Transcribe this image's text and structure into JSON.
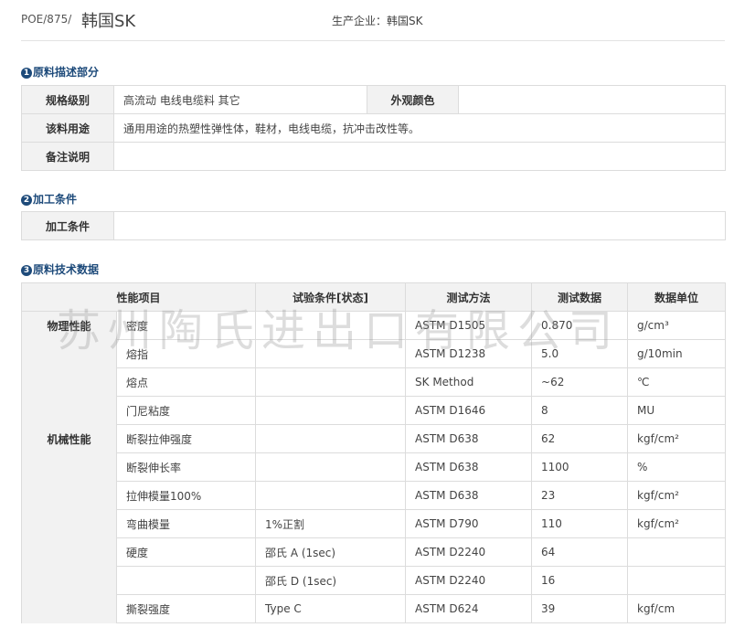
{
  "header": {
    "code": "POE/875/",
    "brand": "韩国SK",
    "producer": "生产企业：韩国SK"
  },
  "section1": {
    "num": "1",
    "title": "原料描述部分",
    "spec_label": "规格级别",
    "spec_value": "高流动 电线电缆料 其它",
    "color_label": "外观颜色",
    "color_value": "",
    "use_label": "该料用途",
    "use_value": "通用用途的热塑性弹性体，鞋材，电线电缆，抗冲击改性等。",
    "note_label": "备注说明",
    "note_value": ""
  },
  "section2": {
    "num": "2",
    "title": "加工条件",
    "label": "加工条件",
    "value": ""
  },
  "section3": {
    "num": "3",
    "title": "原料技术数据",
    "headers": [
      "性能项目",
      "试验条件[状态]",
      "测试方法",
      "测试数据",
      "数据单位"
    ],
    "rows": [
      {
        "group": "物理性能",
        "item": "密度",
        "cond": "",
        "method": "ASTM D1505",
        "data": "0.870",
        "unit": "g/cm³"
      },
      {
        "group": "",
        "item": "熔指",
        "cond": "",
        "method": "ASTM D1238",
        "data": "5.0",
        "unit": "g/10min"
      },
      {
        "group": "",
        "item": "熔点",
        "cond": "",
        "method": "SK Method",
        "data": "~62",
        "unit": "℃"
      },
      {
        "group": "",
        "item": "门尼粘度",
        "cond": "",
        "method": "ASTM D1646",
        "data": "8",
        "unit": "MU"
      },
      {
        "group": "机械性能",
        "item": "断裂拉伸强度",
        "cond": "",
        "method": "ASTM D638",
        "data": "62",
        "unit": "kgf/cm²"
      },
      {
        "group": "",
        "item": "断裂伸长率",
        "cond": "",
        "method": "ASTM D638",
        "data": "1100",
        "unit": "%"
      },
      {
        "group": "",
        "item": "拉伸模量100%",
        "cond": "",
        "method": "ASTM D638",
        "data": "23",
        "unit": "kgf/cm²"
      },
      {
        "group": "",
        "item": "弯曲模量",
        "cond": "1%正割",
        "method": "ASTM D790",
        "data": "110",
        "unit": "kgf/cm²"
      },
      {
        "group": "",
        "item": "硬度",
        "cond": "邵氏 A (1sec)",
        "method": "ASTM D2240",
        "data": "64",
        "unit": ""
      },
      {
        "group": "",
        "item": "",
        "cond": "邵氏 D (1sec)",
        "method": "ASTM D2240",
        "data": "16",
        "unit": ""
      },
      {
        "group": "",
        "item": "撕裂强度",
        "cond": "Type C",
        "method": "ASTM D624",
        "data": "39",
        "unit": "kgf/cm"
      }
    ]
  },
  "watermark": "苏州陶氏进出口有限公司"
}
